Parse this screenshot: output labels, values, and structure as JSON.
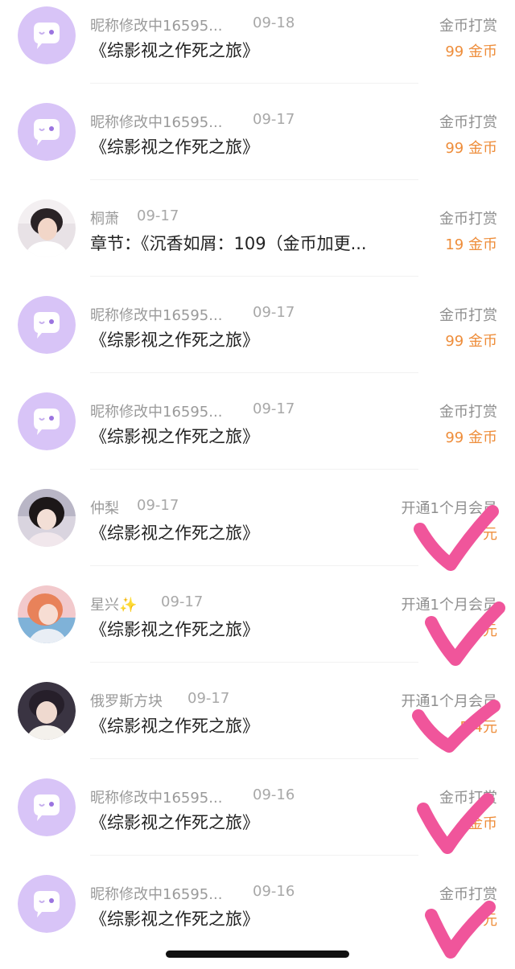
{
  "tips": [
    {
      "name": "昵称修改中16595...",
      "date": "09-18",
      "title": "《综影视之作死之旅》",
      "action": "金币打赏",
      "amount": "99 金币",
      "avatar": "default-purple-chat-avatar"
    },
    {
      "name": "昵称修改中16595...",
      "date": "09-17",
      "title": "《综影视之作死之旅》",
      "action": "金币打赏",
      "amount": "99 金币",
      "avatar": "default-purple-chat-avatar"
    },
    {
      "name": "桐萧",
      "date": "09-17",
      "title": "章节：《沉香如屑：109（金币加更...",
      "action": "金币打赏",
      "amount": "19 金币",
      "avatar": "user-photo-avatar"
    },
    {
      "name": "昵称修改中16595...",
      "date": "09-17",
      "title": "《综影视之作死之旅》",
      "action": "金币打赏",
      "amount": "99 金币",
      "avatar": "default-purple-chat-avatar"
    },
    {
      "name": "昵称修改中16595...",
      "date": "09-17",
      "title": "《综影视之作死之旅》",
      "action": "金币打赏",
      "amount": "99 金币",
      "avatar": "default-purple-chat-avatar"
    },
    {
      "name": "仲梨",
      "date": "09-17",
      "title": "《综影视之作死之旅》",
      "action": "开通1个月会员",
      "amount": "元",
      "avatar": "user-photo-avatar"
    },
    {
      "name": "星兴✨",
      "date": "09-17",
      "title": "《综影视之作死之旅》",
      "action": "开通1个月会员",
      "amount": "元",
      "avatar": "user-photo-avatar"
    },
    {
      "name": "俄罗斯方块",
      "date": "09-17",
      "title": "《综影视之作死之旅》",
      "action": "开通1个月会员",
      "amount": "5.4元",
      "avatar": "user-photo-avatar"
    },
    {
      "name": "昵称修改中16595...",
      "date": "09-16",
      "title": "《综影视之作死之旅》",
      "action": "金币打赏",
      "amount": "9金币",
      "avatar": "default-purple-chat-avatar"
    },
    {
      "name": "昵称修改中16595...",
      "date": "09-16",
      "title": "《综影视之作死之旅》",
      "action": "金币打赏",
      "amount": "9元",
      "avatar": "default-purple-chat-avatar"
    }
  ],
  "colors": {
    "amount": "#ee8d3a",
    "secondary_text": "#9a9a9a",
    "title_text": "#222222",
    "default_avatar_bg": "#d8c4f7",
    "check_mark": "#f0559b"
  }
}
